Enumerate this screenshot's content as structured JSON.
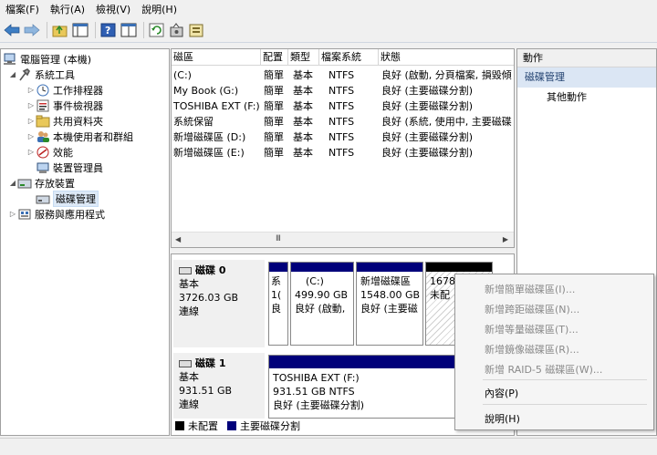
{
  "menu": [
    "檔案(F)",
    "執行(A)",
    "檢視(V)",
    "說明(H)"
  ],
  "toolbar": {
    "icons": [
      "back-arrow-icon",
      "forward-arrow-icon",
      "folder-up-icon",
      "show-tree-icon",
      "help-icon",
      "properties-icon",
      "refresh-icon",
      "settings-icon",
      "export-icon"
    ]
  },
  "tree": {
    "root": "電腦管理 (本機)",
    "items": [
      {
        "label": "系統工具",
        "level": 1
      },
      {
        "label": "工作排程器",
        "level": 2
      },
      {
        "label": "事件檢視器",
        "level": 2
      },
      {
        "label": "共用資料夾",
        "level": 2
      },
      {
        "label": "本機使用者和群組",
        "level": 2
      },
      {
        "label": "效能",
        "level": 2
      },
      {
        "label": "裝置管理員",
        "level": 2
      },
      {
        "label": "存放裝置",
        "level": 1
      },
      {
        "label": "磁碟管理",
        "level": 2,
        "selected": true
      },
      {
        "label": "服務與應用程式",
        "level": 1
      }
    ]
  },
  "volumes": {
    "headers": [
      "磁區",
      "配置",
      "類型",
      "檔案系統",
      "狀態"
    ],
    "rows": [
      {
        "name": "(C:)",
        "layout": "簡單",
        "type": "基本",
        "fs": "NTFS",
        "status": "良好 (啟動, 分頁檔案, 損毀傾"
      },
      {
        "name": "My Book (G:)",
        "layout": "簡單",
        "type": "基本",
        "fs": "NTFS",
        "status": "良好 (主要磁碟分割)"
      },
      {
        "name": "TOSHIBA EXT (F:)",
        "layout": "簡單",
        "type": "基本",
        "fs": "NTFS",
        "status": "良好 (主要磁碟分割)"
      },
      {
        "name": "系統保留",
        "layout": "簡單",
        "type": "基本",
        "fs": "NTFS",
        "status": "良好 (系統, 使用中, 主要磁碟"
      },
      {
        "name": "新增磁碟區 (D:)",
        "layout": "簡單",
        "type": "基本",
        "fs": "NTFS",
        "status": "良好 (主要磁碟分割)"
      },
      {
        "name": "新增磁碟區 (E:)",
        "layout": "簡單",
        "type": "基本",
        "fs": "NTFS",
        "status": "良好 (主要磁碟分割)"
      }
    ],
    "scroll_mark": "III"
  },
  "disks": [
    {
      "title": "磁碟 0",
      "type": "基本",
      "size": "3726.03 GB",
      "state": "連線",
      "partitions": [
        {
          "lines": [
            "系",
            "1(",
            "良"
          ]
        },
        {
          "lines": [
            "(C:)",
            "499.90 GB",
            "良好 (啟動,"
          ]
        },
        {
          "lines": [
            "新增磁碟區",
            "1548.00 GB",
            "良好 (主要磁"
          ]
        },
        {
          "lines": [
            "1678",
            "未配"
          ]
        }
      ]
    },
    {
      "title": "磁碟 1",
      "type": "基本",
      "size": "931.51 GB",
      "state": "連線",
      "partitions": [
        {
          "lines": [
            "TOSHIBA EXT  (F:)",
            "931.51 GB NTFS",
            "良好 (主要磁碟分割)"
          ]
        }
      ]
    }
  ],
  "legend": {
    "unallocated": "未配置",
    "primary": "主要磁碟分割"
  },
  "actions": {
    "header": "動作",
    "section": "磁碟管理",
    "more": "其他動作"
  },
  "context_menu": {
    "items": [
      {
        "label": "新增簡單磁碟區(I)...",
        "disabled": true
      },
      {
        "label": "新增跨距磁碟區(N)...",
        "disabled": true
      },
      {
        "label": "新增等量磁碟區(T)...",
        "disabled": true
      },
      {
        "label": "新增鏡像磁碟區(R)...",
        "disabled": true
      },
      {
        "label": "新增 RAID-5 磁碟區(W)...",
        "disabled": true
      },
      {
        "label": "內容(P)",
        "disabled": false
      },
      {
        "label": "說明(H)",
        "disabled": false
      }
    ]
  },
  "colors": {
    "primary_partition": "#00007a",
    "unallocated": "#000000",
    "selection": "#dde9f7"
  }
}
